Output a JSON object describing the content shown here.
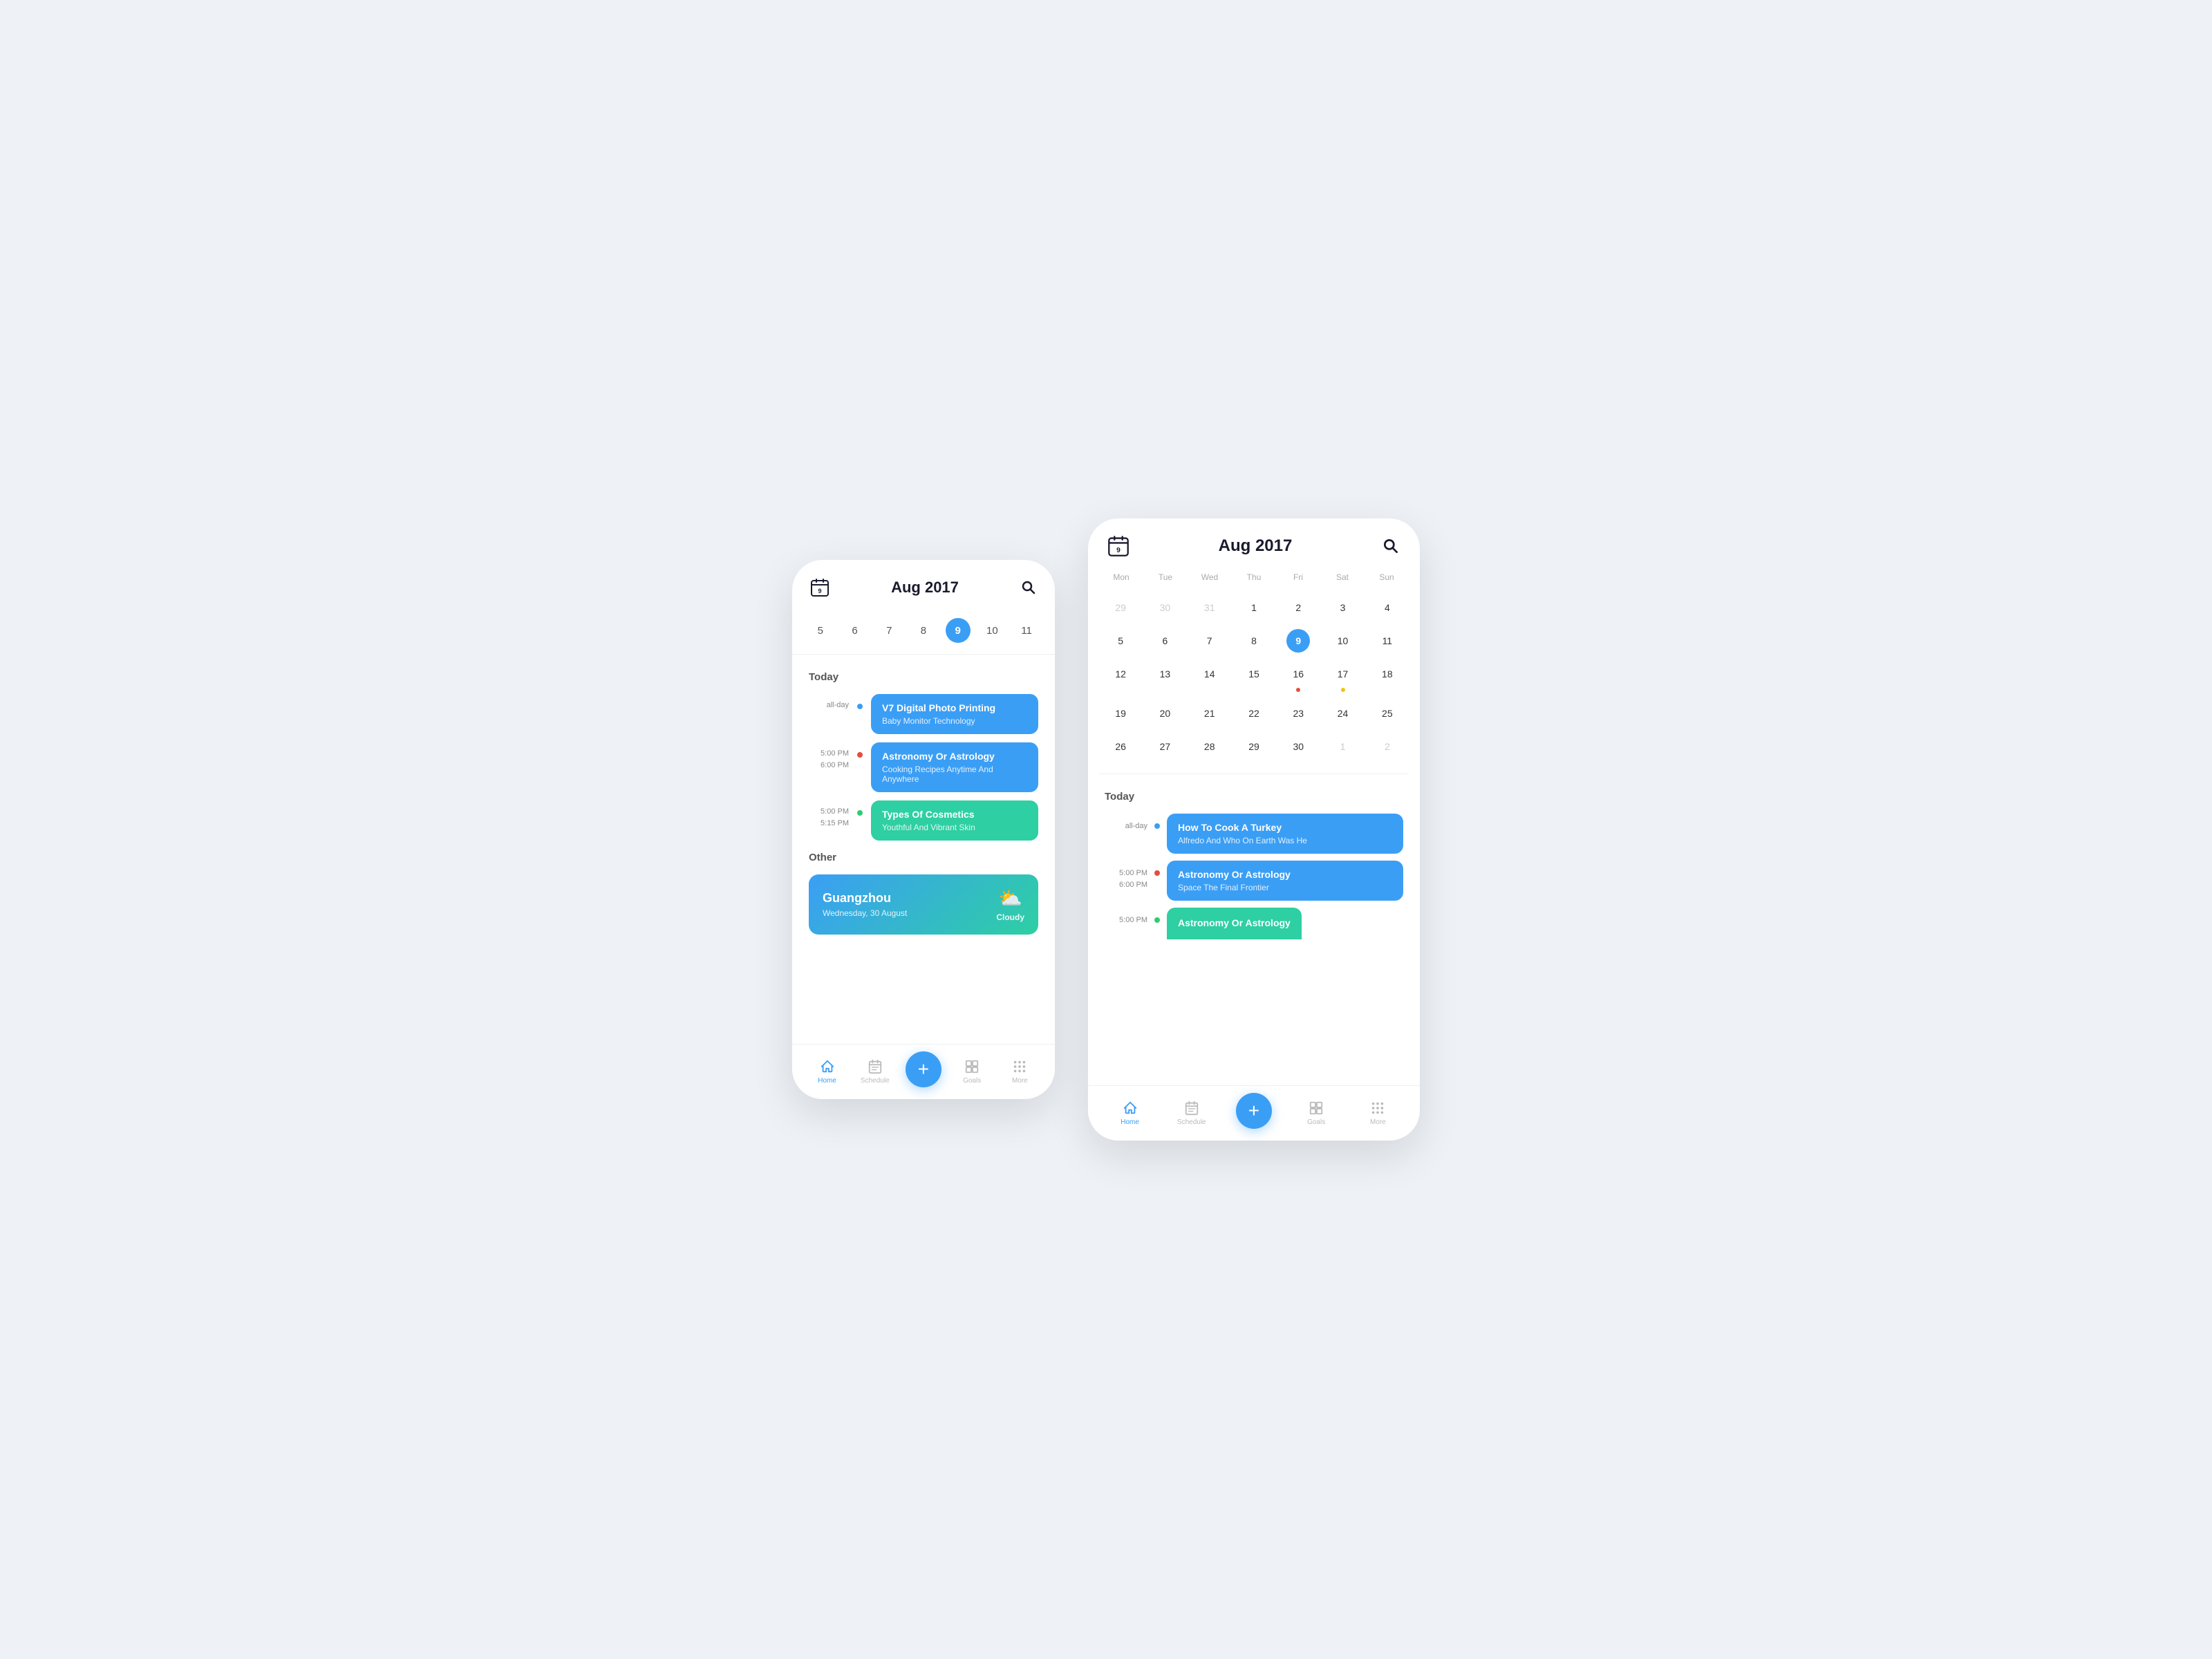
{
  "phone1": {
    "header": {
      "month_year": "Aug 2017",
      "calendar_label": "9"
    },
    "week_days": [
      {
        "num": "5",
        "active": false
      },
      {
        "num": "6",
        "active": false
      },
      {
        "num": "7",
        "active": false
      },
      {
        "num": "8",
        "active": false
      },
      {
        "num": "9",
        "active": true
      },
      {
        "num": "10",
        "active": false
      },
      {
        "num": "11",
        "active": false
      }
    ],
    "today_label": "Today",
    "events": [
      {
        "time_start": "all-day",
        "time_end": "",
        "dot_color": "blue",
        "card_color": "blue",
        "title": "V7 Digital Photo Printing",
        "subtitle": "Baby Monitor Technology"
      },
      {
        "time_start": "5:00 PM",
        "time_end": "6:00 PM",
        "dot_color": "red",
        "card_color": "blue",
        "title": "Astronomy Or Astrology",
        "subtitle": "Cooking Recipes Anytime And Anywhere"
      },
      {
        "time_start": "5:00 PM",
        "time_end": "5:15 PM",
        "dot_color": "green",
        "card_color": "green",
        "title": "Types Of Cosmetics",
        "subtitle": "Youthful And Vibrant Skin"
      }
    ],
    "other_label": "Other",
    "weather": {
      "city": "Guangzhou",
      "date": "Wednesday, 30 August",
      "condition": "Cloudy"
    },
    "nav": {
      "items": [
        {
          "label": "Home",
          "active": true
        },
        {
          "label": "Schedule",
          "active": false
        },
        {
          "label": "",
          "fab": true
        },
        {
          "label": "Goals",
          "active": false
        },
        {
          "label": "More",
          "active": false
        }
      ]
    }
  },
  "phone2": {
    "header": {
      "month_year": "Aug 2017"
    },
    "weekdays": [
      "Mon",
      "Tue",
      "Wed",
      "Thu",
      "Fri",
      "Sat",
      "Sun"
    ],
    "calendar_rows": [
      [
        {
          "num": "29",
          "other": true,
          "today": false,
          "dot": null
        },
        {
          "num": "30",
          "other": true,
          "today": false,
          "dot": null
        },
        {
          "num": "31",
          "other": true,
          "today": false,
          "dot": null
        },
        {
          "num": "1",
          "other": false,
          "today": false,
          "dot": null
        },
        {
          "num": "2",
          "other": false,
          "today": false,
          "dot": null
        },
        {
          "num": "3",
          "other": false,
          "today": false,
          "dot": null
        },
        {
          "num": "4",
          "other": false,
          "today": false,
          "dot": null
        }
      ],
      [
        {
          "num": "5",
          "other": false,
          "today": false,
          "dot": null
        },
        {
          "num": "6",
          "other": false,
          "today": false,
          "dot": null
        },
        {
          "num": "7",
          "other": false,
          "today": false,
          "dot": null
        },
        {
          "num": "8",
          "other": false,
          "today": false,
          "dot": null
        },
        {
          "num": "9",
          "other": false,
          "today": true,
          "dot": null
        },
        {
          "num": "10",
          "other": false,
          "today": false,
          "dot": null
        },
        {
          "num": "11",
          "other": false,
          "today": false,
          "dot": null
        }
      ],
      [
        {
          "num": "12",
          "other": false,
          "today": false,
          "dot": null
        },
        {
          "num": "13",
          "other": false,
          "today": false,
          "dot": null
        },
        {
          "num": "14",
          "other": false,
          "today": false,
          "dot": null
        },
        {
          "num": "15",
          "other": false,
          "today": false,
          "dot": null
        },
        {
          "num": "16",
          "other": false,
          "today": false,
          "dot": "red"
        },
        {
          "num": "17",
          "other": false,
          "today": false,
          "dot": "yellow"
        },
        {
          "num": "18",
          "other": false,
          "today": false,
          "dot": null
        }
      ],
      [
        {
          "num": "19",
          "other": false,
          "today": false,
          "dot": null
        },
        {
          "num": "20",
          "other": false,
          "today": false,
          "dot": null
        },
        {
          "num": "21",
          "other": false,
          "today": false,
          "dot": null
        },
        {
          "num": "22",
          "other": false,
          "today": false,
          "dot": null
        },
        {
          "num": "23",
          "other": false,
          "today": false,
          "dot": null
        },
        {
          "num": "24",
          "other": false,
          "today": false,
          "dot": null
        },
        {
          "num": "25",
          "other": false,
          "today": false,
          "dot": null
        }
      ],
      [
        {
          "num": "26",
          "other": false,
          "today": false,
          "dot": null
        },
        {
          "num": "27",
          "other": false,
          "today": false,
          "dot": null
        },
        {
          "num": "28",
          "other": false,
          "today": false,
          "dot": null
        },
        {
          "num": "29",
          "other": false,
          "today": false,
          "dot": null
        },
        {
          "num": "30",
          "other": false,
          "today": false,
          "dot": null
        },
        {
          "num": "1",
          "other": true,
          "today": false,
          "dot": null
        },
        {
          "num": "2",
          "other": true,
          "today": false,
          "dot": null
        }
      ]
    ],
    "today_label": "Today",
    "events": [
      {
        "time_start": "all-day",
        "time_end": "",
        "dot_color": "blue",
        "card_color": "blue",
        "title": "How To Cook A Turkey",
        "subtitle": "Alfredo And Who On Earth Was He"
      },
      {
        "time_start": "5:00 PM",
        "time_end": "6:00 PM",
        "dot_color": "red",
        "card_color": "blue",
        "title": "Astronomy Or Astrology",
        "subtitle": "Space The Final Frontier"
      },
      {
        "time_start": "5:00 PM",
        "time_end": "",
        "dot_color": "green",
        "card_color": "green",
        "title": "Astronomy Or Astrology",
        "subtitle": ""
      }
    ],
    "nav": {
      "items": [
        {
          "label": "Home",
          "active": true
        },
        {
          "label": "Schedule",
          "active": false
        },
        {
          "label": "",
          "fab": true
        },
        {
          "label": "Goals",
          "active": false
        },
        {
          "label": "More",
          "active": false
        }
      ]
    }
  }
}
